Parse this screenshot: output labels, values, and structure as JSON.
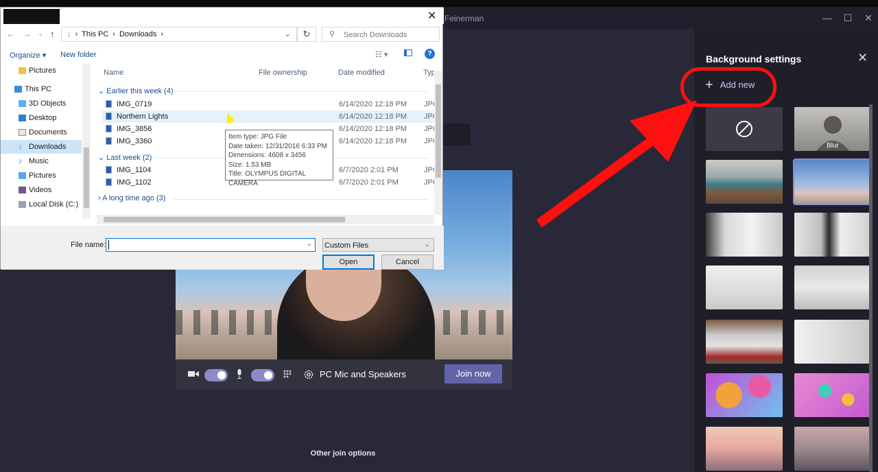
{
  "teams": {
    "window_title": "Feinerman",
    "window_controls": [
      "—",
      "☐",
      "✕"
    ]
  },
  "background_settings": {
    "title": "Background settings",
    "add_new_label": "Add new",
    "blur_label": "Blur",
    "close_icon": "close-icon"
  },
  "preview": {
    "audio_device": "PC Mic and Speakers",
    "join_label": "Join now",
    "other_join": "Other join options"
  },
  "dialog": {
    "breadcrumb": [
      "This PC",
      "Downloads"
    ],
    "search_placeholder": "Search Downloads",
    "organize": "Organize ▾",
    "new_folder": "New folder",
    "nav": [
      {
        "label": "Pictures",
        "icon": "folder-icon"
      },
      {
        "label": "This PC",
        "icon": "pc-icon"
      },
      {
        "label": "3D Objects",
        "icon": "3d-icon"
      },
      {
        "label": "Desktop",
        "icon": "desktop-icon"
      },
      {
        "label": "Documents",
        "icon": "documents-icon"
      },
      {
        "label": "Downloads",
        "icon": "downloads-icon"
      },
      {
        "label": "Music",
        "icon": "music-icon"
      },
      {
        "label": "Pictures",
        "icon": "pictures-icon"
      },
      {
        "label": "Videos",
        "icon": "videos-icon"
      },
      {
        "label": "Local Disk (C:)",
        "icon": "disk-icon"
      }
    ],
    "columns": {
      "name": "Name",
      "ownership": "File ownership",
      "modified": "Date modified",
      "type": "Typ"
    },
    "groups": [
      {
        "label": "Earlier this week (4)",
        "files": [
          {
            "name": "IMG_0719",
            "date": "6/14/2020 12:18 PM",
            "type": "JPG"
          },
          {
            "name": "Northern Lights",
            "date": "6/14/2020 12:18 PM",
            "type": "JPG"
          },
          {
            "name": "IMG_3856",
            "date": "6/14/2020 12:18 PM",
            "type": "JPG"
          },
          {
            "name": "IMG_3360",
            "date": "6/14/2020 12:18 PM",
            "type": "JPG"
          }
        ]
      },
      {
        "label": "Last week (2)",
        "files": [
          {
            "name": "IMG_1104",
            "date": "6/7/2020 2:01 PM",
            "type": "JPG"
          },
          {
            "name": "IMG_1102",
            "date": "6/7/2020 2:01 PM",
            "type": "JPG"
          }
        ]
      },
      {
        "label": "A long time ago (3)",
        "files": []
      }
    ],
    "tooltip": {
      "line1": "Item type: JPG File",
      "line2": "Date taken: 12/31/2016 6:33 PM",
      "line3": "Dimensions: 4608 x 3456",
      "line4": "Size: 1.53 MB",
      "line5": "Title: OLYMPUS DIGITAL CAMERA"
    },
    "file_name_label": "File name:",
    "file_name_value": "",
    "file_type": "Custom Files",
    "open_label": "Open",
    "cancel_label": "Cancel"
  },
  "colors": {
    "accent": "#6264a7",
    "annotation": "#ff1010"
  }
}
